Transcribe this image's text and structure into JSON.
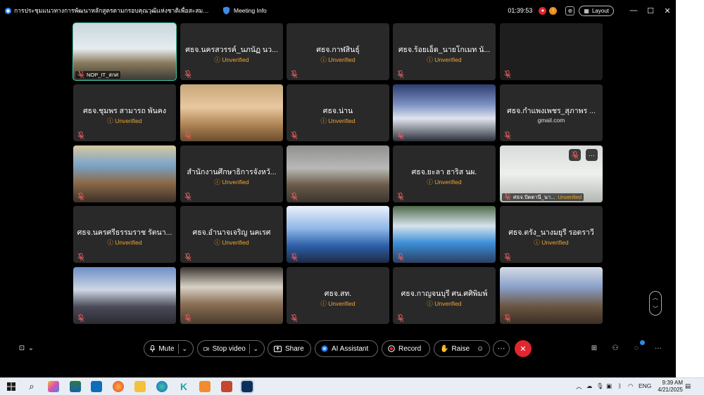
{
  "window": {
    "title": "การประชุมแนวทางการพัฒนาหลักสูตรตามกรอบคุณวุฒิแห่งชาติเพื่อสะสมและเทียบโอน...",
    "meeting_info_label": "Meeting Info",
    "timer": "01:39:53",
    "layout_label": "Layout",
    "controls": {
      "minimize": "—",
      "maximize": "☐",
      "close": "✕"
    }
  },
  "participants": [
    {
      "name": "NOP_IT_สกศ",
      "status": "",
      "kind": "video",
      "active": true
    },
    {
      "name": "ศธจ.นครสวรรค์_นภนัฏ นว...",
      "status": "Unverified",
      "kind": "name"
    },
    {
      "name": "ศธจ.กาฬสินธุ์",
      "status": "Unverified",
      "kind": "name"
    },
    {
      "name": "ศธจ.ร้อยเอ็ด_นายโกเมท นั...",
      "status": "Unverified",
      "kind": "name"
    },
    {
      "name": "",
      "status": "",
      "kind": "blank"
    },
    {
      "name": "ศธจ.ชุมพร สามารถ พันคง",
      "status": "Unverified",
      "kind": "name"
    },
    {
      "name": "",
      "status": "",
      "kind": "video"
    },
    {
      "name": "ศธจ.น่าน",
      "status": "Unverified",
      "kind": "name"
    },
    {
      "name": "",
      "status": "",
      "kind": "video"
    },
    {
      "name": "ศธจ.กำแพงเพชร_สุภาพร ...",
      "status": "gmail.com",
      "kind": "name",
      "plain": true
    },
    {
      "name": "",
      "status": "",
      "kind": "video"
    },
    {
      "name": "สำนักงานศึกษาธิการจังหวั...",
      "status": "Unverified",
      "kind": "name"
    },
    {
      "name": "",
      "status": "",
      "kind": "video"
    },
    {
      "name": "ศธจ.ยะลา ฮาริส นผ.",
      "status": "Unverified",
      "kind": "name"
    },
    {
      "name": "ศธจ.ปัตตานี_นา...",
      "status": "Unverified",
      "kind": "video-tag"
    },
    {
      "name": "ศธจ.นครศรีธรรมราช รัตนา...",
      "status": "Unverified",
      "kind": "name"
    },
    {
      "name": "ศธจ.อำนาจเจริญ นคเรศ",
      "status": "Unverified",
      "kind": "name"
    },
    {
      "name": "",
      "status": "",
      "kind": "video"
    },
    {
      "name": "",
      "status": "",
      "kind": "video"
    },
    {
      "name": "ศธจ.ตรัง_นางมยุรี รอดราวี",
      "status": "Unverified",
      "kind": "name"
    },
    {
      "name": "",
      "status": "",
      "kind": "video"
    },
    {
      "name": "",
      "status": "",
      "kind": "video"
    },
    {
      "name": "ศธจ.สท.",
      "status": "Unverified",
      "kind": "name"
    },
    {
      "name": "ศธจ.กาญจนบุรี ศน.ศศิพิมพ์",
      "status": "Unverified",
      "kind": "name"
    },
    {
      "name": "",
      "status": "",
      "kind": "video"
    }
  ],
  "toolbar": {
    "mute": "Mute",
    "stop_video": "Stop video",
    "share": "Share",
    "ai_assistant": "AI Assistant",
    "record": "Record",
    "raise": "Raise"
  },
  "taskbar": {
    "lang": "ENG",
    "time": "9:39 AM",
    "date": "4/21/2025"
  },
  "colors": {
    "unverified": "#f0a531",
    "active_border": "#3ec7a9",
    "end_button": "#e0262f",
    "tile_bg": "#292929"
  }
}
